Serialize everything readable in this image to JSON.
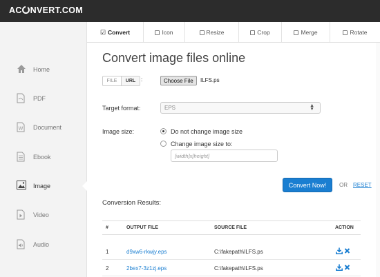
{
  "brand": {
    "logo_pre": "AC",
    "logo_post": "NVERT.COM"
  },
  "sidebar": {
    "items": [
      {
        "label": "Home",
        "icon": "home-icon"
      },
      {
        "label": "PDF",
        "icon": "pdf-file-icon"
      },
      {
        "label": "Document",
        "icon": "document-icon"
      },
      {
        "label": "Ebook",
        "icon": "ebook-icon"
      },
      {
        "label": "Image",
        "icon": "image-icon",
        "active": true
      },
      {
        "label": "Video",
        "icon": "video-icon"
      },
      {
        "label": "Audio",
        "icon": "audio-icon"
      }
    ]
  },
  "tabs": [
    {
      "label": "Convert",
      "active": true
    },
    {
      "label": "Icon"
    },
    {
      "label": "Resize"
    },
    {
      "label": "Crop"
    },
    {
      "label": "Merge"
    },
    {
      "label": "Rotate"
    }
  ],
  "main": {
    "title": "Convert image files online",
    "source_toggle": {
      "file_label": "FILE",
      "url_label": "URL",
      "colon": ":"
    },
    "choose_file_label": "Choose File",
    "file_name": "ILFS.ps",
    "target_format_label": "Target format:",
    "target_format_value": "EPS",
    "image_size_label": "Image size:",
    "size_options": [
      {
        "label": "Do not change image size",
        "selected": true
      },
      {
        "label": "Change image size to:",
        "selected": false
      }
    ],
    "size_placeholder": "[width]x[height]",
    "convert_label": "Convert Now!",
    "or_label": "OR",
    "reset_label": "RESET"
  },
  "results": {
    "title": "Conversion Results:",
    "columns": [
      "#",
      "OUTPUT FILE",
      "SOURCE FILE",
      "ACTION"
    ],
    "rows": [
      {
        "num": "1",
        "output": "d9xw6-rkwjy.eps",
        "source": "C:\\fakepath\\ILFS.ps"
      },
      {
        "num": "2",
        "output": "2bex7-3z1zj.eps",
        "source": "C:\\fakepath\\ILFS.ps"
      }
    ]
  },
  "colors": {
    "accent": "#1a7ed1",
    "topbar": "#2c2c2c",
    "sidebar": "#f3f3f3"
  }
}
